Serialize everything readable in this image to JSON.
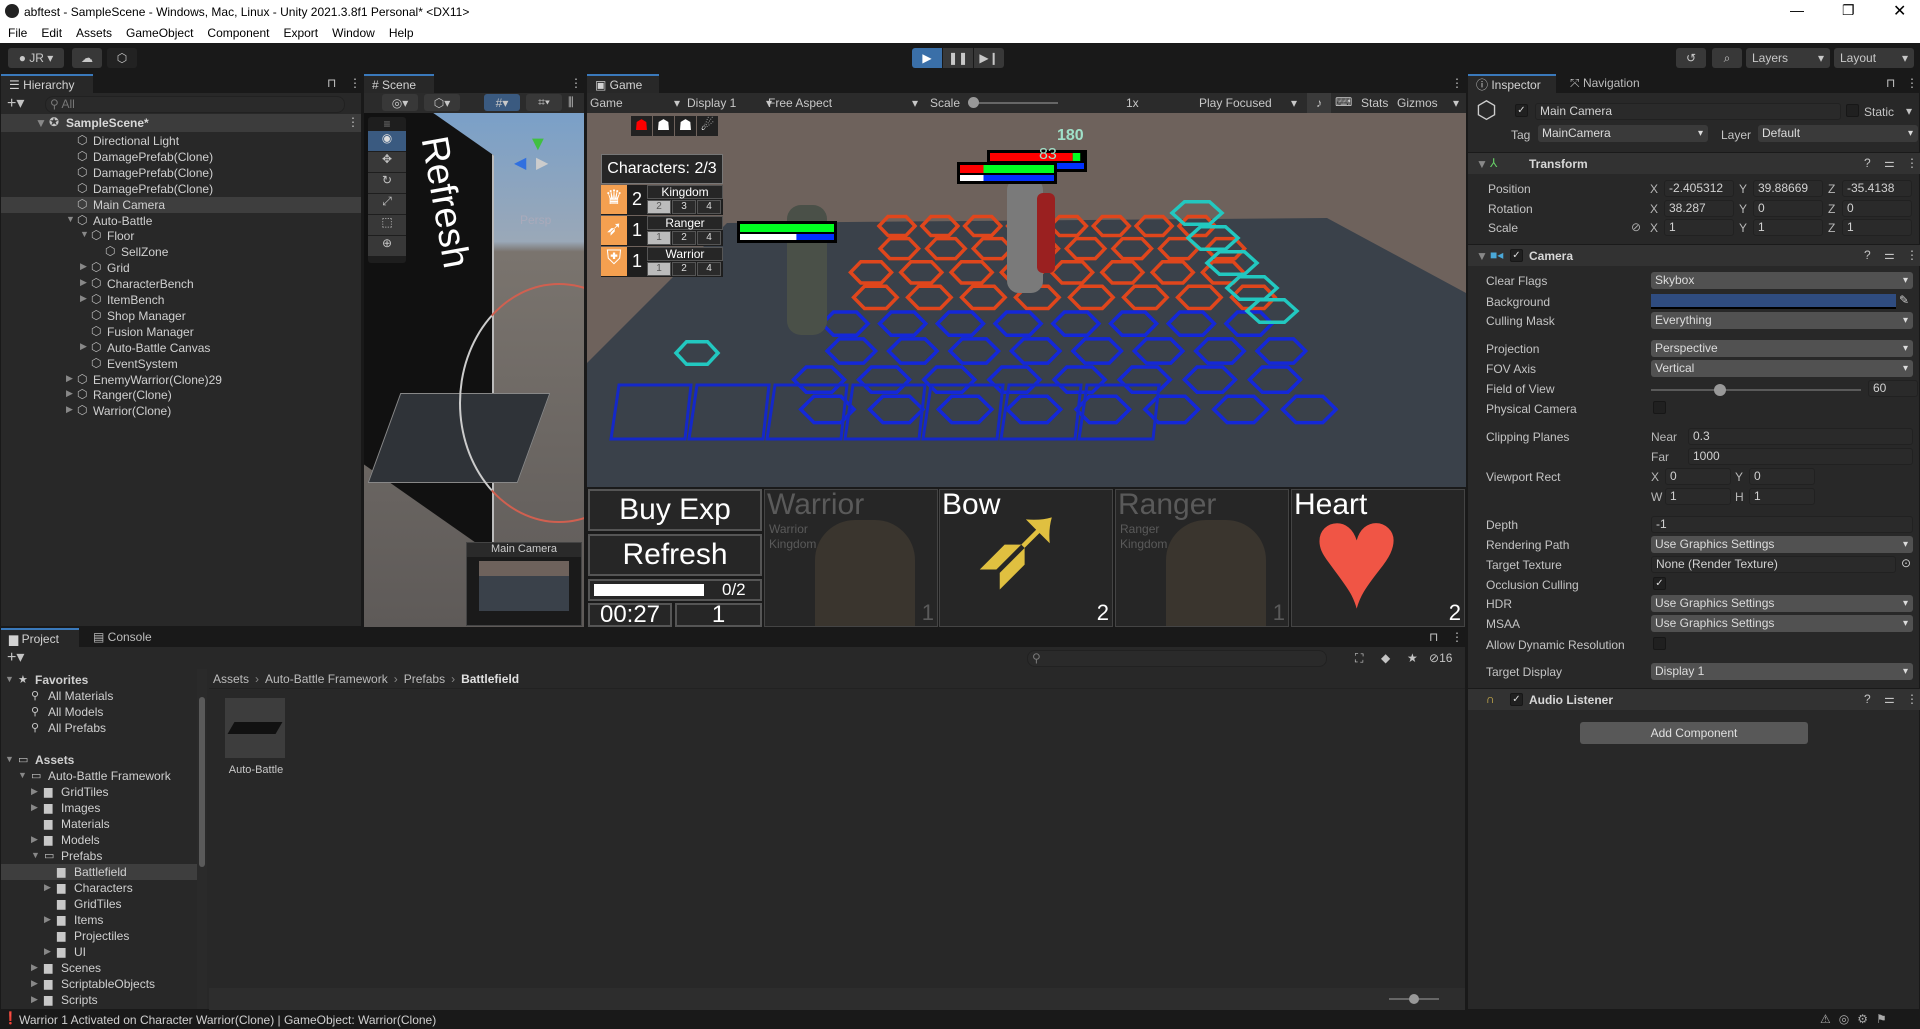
{
  "window": {
    "title": "abftest - SampleScene - Windows, Mac, Linux - Unity 2021.3.8f1 Personal* <DX11>"
  },
  "menu": [
    "File",
    "Edit",
    "Assets",
    "GameObject",
    "Component",
    "Export",
    "Window",
    "Help"
  ],
  "toolbar": {
    "account": "JR",
    "layers": "Layers",
    "layout": "Layout"
  },
  "hierarchy": {
    "tab": "Hierarchy",
    "search_placeholder": "All",
    "scene": "SampleScene*",
    "items": [
      {
        "label": "Directional Light",
        "depth": 1,
        "arrow": ""
      },
      {
        "label": "DamagePrefab(Clone)",
        "depth": 1,
        "arrow": ""
      },
      {
        "label": "DamagePrefab(Clone)",
        "depth": 1,
        "arrow": ""
      },
      {
        "label": "DamagePrefab(Clone)",
        "depth": 1,
        "arrow": ""
      },
      {
        "label": "Main Camera",
        "depth": 1,
        "arrow": "",
        "selected": true
      },
      {
        "label": "Auto-Battle",
        "depth": 1,
        "arrow": "down"
      },
      {
        "label": "Floor",
        "depth": 2,
        "arrow": "down"
      },
      {
        "label": "SellZone",
        "depth": 3,
        "arrow": ""
      },
      {
        "label": "Grid",
        "depth": 2,
        "arrow": "right"
      },
      {
        "label": "CharacterBench",
        "depth": 2,
        "arrow": "right"
      },
      {
        "label": "ItemBench",
        "depth": 2,
        "arrow": "right"
      },
      {
        "label": "Shop Manager",
        "depth": 2,
        "arrow": ""
      },
      {
        "label": "Fusion Manager",
        "depth": 2,
        "arrow": ""
      },
      {
        "label": "Auto-Battle Canvas",
        "depth": 2,
        "arrow": "right"
      },
      {
        "label": "EventSystem",
        "depth": 2,
        "arrow": ""
      },
      {
        "label": "EnemyWarrior(Clone)29",
        "depth": 1,
        "arrow": "right"
      },
      {
        "label": "Ranger(Clone)",
        "depth": 1,
        "arrow": "right"
      },
      {
        "label": "Warrior(Clone)",
        "depth": 1,
        "arrow": "right"
      }
    ]
  },
  "scene": {
    "tab": "Scene",
    "persp": "Persp",
    "overlay_text": "Refresh",
    "camera_preview": "Main Camera"
  },
  "game": {
    "tab": "Game",
    "mode": "Game",
    "display": "Display 1",
    "aspect": "Free Aspect",
    "scale_label": "Scale",
    "scale_value": "1x",
    "play_mode": "Play Focused",
    "stats": "Stats",
    "gizmos": "Gizmos",
    "damage_numbers": [
      "180",
      "83"
    ],
    "characters_label": "Characters: 2/3",
    "traits": [
      {
        "count": "2",
        "name": "Kingdom",
        "levels": [
          "2",
          "3",
          "4"
        ],
        "active": 0,
        "icon": "crown-icon"
      },
      {
        "count": "1",
        "name": "Ranger",
        "levels": [
          "1",
          "2",
          "4"
        ],
        "active": 0,
        "icon": "bow-icon"
      },
      {
        "count": "1",
        "name": "Warrior",
        "levels": [
          "1",
          "2",
          "4"
        ],
        "active": 0,
        "icon": "shield-icon"
      }
    ],
    "buy_exp": "Buy Exp",
    "refresh": "Refresh",
    "exp_progress": "0/2",
    "exp_fraction": 0,
    "timer": "00:27",
    "level": "1",
    "shop": [
      {
        "title": "Warrior",
        "traits": [
          "Warrior",
          "Kingdom"
        ],
        "cost": "1",
        "dim": true
      },
      {
        "title": "Bow",
        "traits": [],
        "cost": "2",
        "dim": false
      },
      {
        "title": "Ranger",
        "traits": [
          "Ranger",
          "Kingdom"
        ],
        "cost": "1",
        "dim": true
      },
      {
        "title": "Heart",
        "traits": [],
        "cost": "2",
        "dim": false
      }
    ],
    "colors": {
      "enemy_tiles": "#e0461c",
      "ally_tiles": "#1428d8",
      "bench_tiles": "#1428c8",
      "sell_tiles": "#22c8c0",
      "health": "#00ff20",
      "damage": "#ff0000",
      "mana": "#0030ff"
    }
  },
  "inspector": {
    "tab": "Inspector",
    "tab2": "Navigation",
    "object_name": "Main Camera",
    "static": "Static",
    "tag_label": "Tag",
    "tag": "MainCamera",
    "layer_label": "Layer",
    "layer": "Default",
    "transform": {
      "title": "Transform",
      "rows": [
        {
          "label": "Position",
          "x": "-2.405312",
          "y": "39.88669",
          "z": "-35.4138"
        },
        {
          "label": "Rotation",
          "x": "38.287",
          "y": "0",
          "z": "0"
        },
        {
          "label": "Scale",
          "x": "1",
          "y": "1",
          "z": "1"
        }
      ]
    },
    "camera": {
      "title": "Camera",
      "clear_flags": [
        "Clear Flags",
        "Skybox"
      ],
      "background": [
        "Background",
        "#2f4c80"
      ],
      "culling_mask": [
        "Culling Mask",
        "Everything"
      ],
      "projection": [
        "Projection",
        "Perspective"
      ],
      "fov_axis": [
        "FOV Axis",
        "Vertical"
      ],
      "fov": [
        "Field of View",
        "60"
      ],
      "fov_fraction": 0.33,
      "physical": "Physical Camera",
      "clipping": {
        "label": "Clipping Planes",
        "near_label": "Near",
        "near": "0.3",
        "far_label": "Far",
        "far": "1000"
      },
      "viewport": {
        "label": "Viewport Rect",
        "x": "0",
        "y": "0",
        "w": "1",
        "h": "1"
      },
      "depth": [
        "Depth",
        "-1"
      ],
      "rendering_path": [
        "Rendering Path",
        "Use Graphics Settings"
      ],
      "target_texture": [
        "Target Texture",
        "None (Render Texture)"
      ],
      "occlusion": "Occlusion Culling",
      "hdr": [
        "HDR",
        "Use Graphics Settings"
      ],
      "msaa": [
        "MSAA",
        "Use Graphics Settings"
      ],
      "dynamic_res": "Allow Dynamic Resolution",
      "target_display": [
        "Target Display",
        "Display 1"
      ]
    },
    "audio_listener": "Audio Listener",
    "add_component": "Add Component"
  },
  "project": {
    "tab": "Project",
    "tab2": "Console",
    "hidden_count": "16",
    "breadcrumb": [
      "Assets",
      "Auto-Battle Framework",
      "Prefabs",
      "Battlefield"
    ],
    "tree": [
      {
        "label": "Favorites",
        "depth": 0,
        "arrow": "down",
        "icon": "star",
        "bold": true
      },
      {
        "label": "All Materials",
        "depth": 1,
        "arrow": "",
        "icon": "search"
      },
      {
        "label": "All Models",
        "depth": 1,
        "arrow": "",
        "icon": "search"
      },
      {
        "label": "All Prefabs",
        "depth": 1,
        "arrow": "",
        "icon": "search"
      },
      {
        "label": "",
        "depth": 0,
        "arrow": "",
        "icon": ""
      },
      {
        "label": "Assets",
        "depth": 0,
        "arrow": "down",
        "icon": "folder-open",
        "bold": true
      },
      {
        "label": "Auto-Battle Framework",
        "depth": 1,
        "arrow": "down",
        "icon": "folder-open"
      },
      {
        "label": "GridTiles",
        "depth": 2,
        "arrow": "right",
        "icon": "folder"
      },
      {
        "label": "Images",
        "depth": 2,
        "arrow": "right",
        "icon": "folder"
      },
      {
        "label": "Materials",
        "depth": 2,
        "arrow": "",
        "icon": "folder"
      },
      {
        "label": "Models",
        "depth": 2,
        "arrow": "right",
        "icon": "folder"
      },
      {
        "label": "Prefabs",
        "depth": 2,
        "arrow": "down",
        "icon": "folder-open"
      },
      {
        "label": "Battlefield",
        "depth": 3,
        "arrow": "",
        "icon": "folder",
        "selected": true
      },
      {
        "label": "Characters",
        "depth": 3,
        "arrow": "right",
        "icon": "folder"
      },
      {
        "label": "GridTiles",
        "depth": 3,
        "arrow": "",
        "icon": "folder"
      },
      {
        "label": "Items",
        "depth": 3,
        "arrow": "right",
        "icon": "folder"
      },
      {
        "label": "Projectiles",
        "depth": 3,
        "arrow": "",
        "icon": "folder"
      },
      {
        "label": "UI",
        "depth": 3,
        "arrow": "right",
        "icon": "folder"
      },
      {
        "label": "Scenes",
        "depth": 2,
        "arrow": "right",
        "icon": "folder"
      },
      {
        "label": "ScriptableObjects",
        "depth": 2,
        "arrow": "right",
        "icon": "folder"
      },
      {
        "label": "Scripts",
        "depth": 2,
        "arrow": "right",
        "icon": "folder"
      }
    ],
    "assets": [
      {
        "label": "Auto-Battle"
      }
    ]
  },
  "status": {
    "message": "Warrior 1 Activated on Character Warrior(Clone) | GameObject: Warrior(Clone)"
  }
}
